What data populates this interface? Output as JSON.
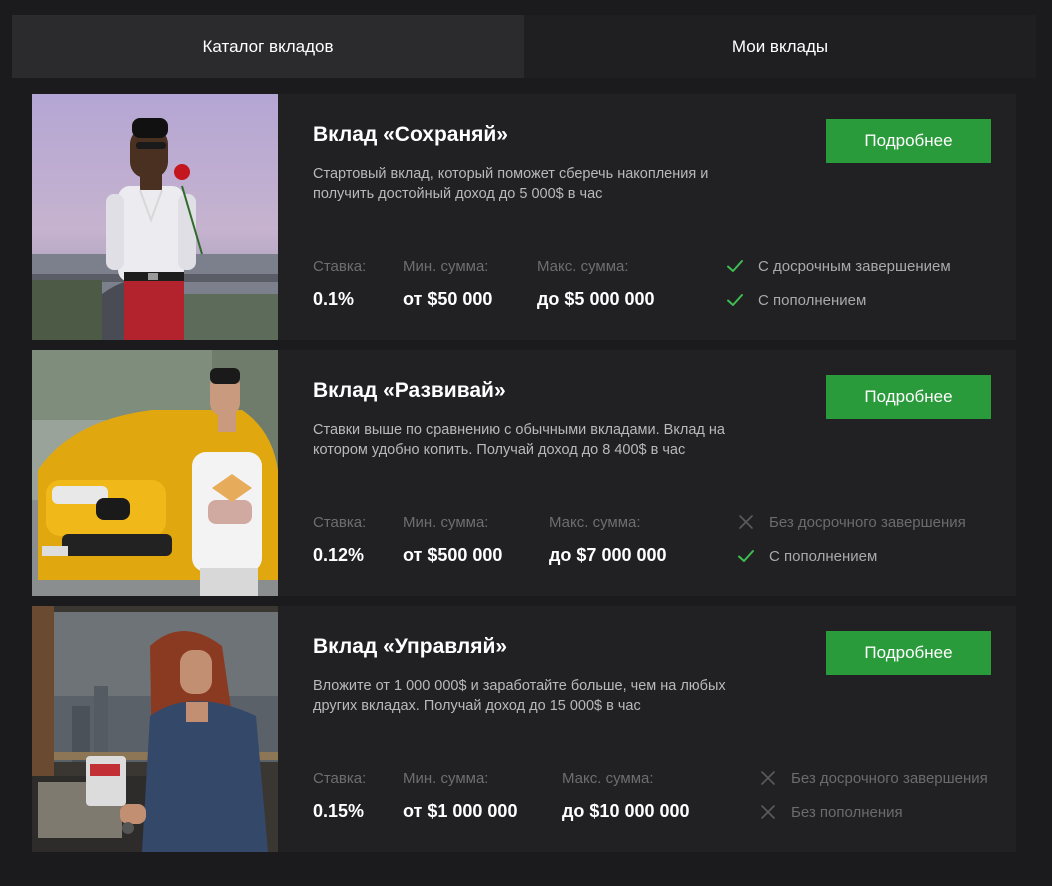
{
  "tabs": [
    {
      "label": "Каталог вкладов",
      "active": true
    },
    {
      "label": "Мои вклады",
      "active": false
    }
  ],
  "stat_labels": {
    "rate": "Ставка:",
    "min": "Мин. сумма:",
    "max": "Макс. сумма:"
  },
  "colors": {
    "accent": "#2a9b3a",
    "check": "#3fbd52",
    "cross": "#5b5b5f",
    "card_bg": "#212123",
    "page_bg": "#1b1b1d"
  },
  "deposits": [
    {
      "title": "Вклад «Сохраняй»",
      "description": "Стартовый вклад, который поможет сберечь накопления и получить достойный доход до 5 000$ в час",
      "button_label": "Подробнее",
      "rate": "0.1%",
      "min_amount": "от $50 000",
      "max_amount": "до $5 000 000",
      "features": [
        {
          "label": "С досрочным завершением",
          "available": true
        },
        {
          "label": "С пополнением",
          "available": true
        }
      ]
    },
    {
      "title": "Вклад «Развивай»",
      "description": "Ставки выше по сравнению с обычными вкладами. Вклад на котором удобно копить. Получай доход до 8 400$ в час",
      "button_label": "Подробнее",
      "rate": "0.12%",
      "min_amount": "от $500 000",
      "max_amount": "до $7 000 000",
      "features": [
        {
          "label": "Без досрочного завершения",
          "available": false
        },
        {
          "label": "С пополнением",
          "available": true
        }
      ]
    },
    {
      "title": "Вклад «Управляй»",
      "description": "Вложите от 1 000 000$ и заработайте больше, чем на любых других вкладах. Получай доход до 15 000$ в час",
      "button_label": "Подробнее",
      "rate": "0.15%",
      "min_amount": "от $1 000 000",
      "max_amount": "до $10 000 000",
      "features": [
        {
          "label": "Без досрочного завершения",
          "available": false
        },
        {
          "label": "Без пополнения",
          "available": false
        }
      ]
    }
  ]
}
